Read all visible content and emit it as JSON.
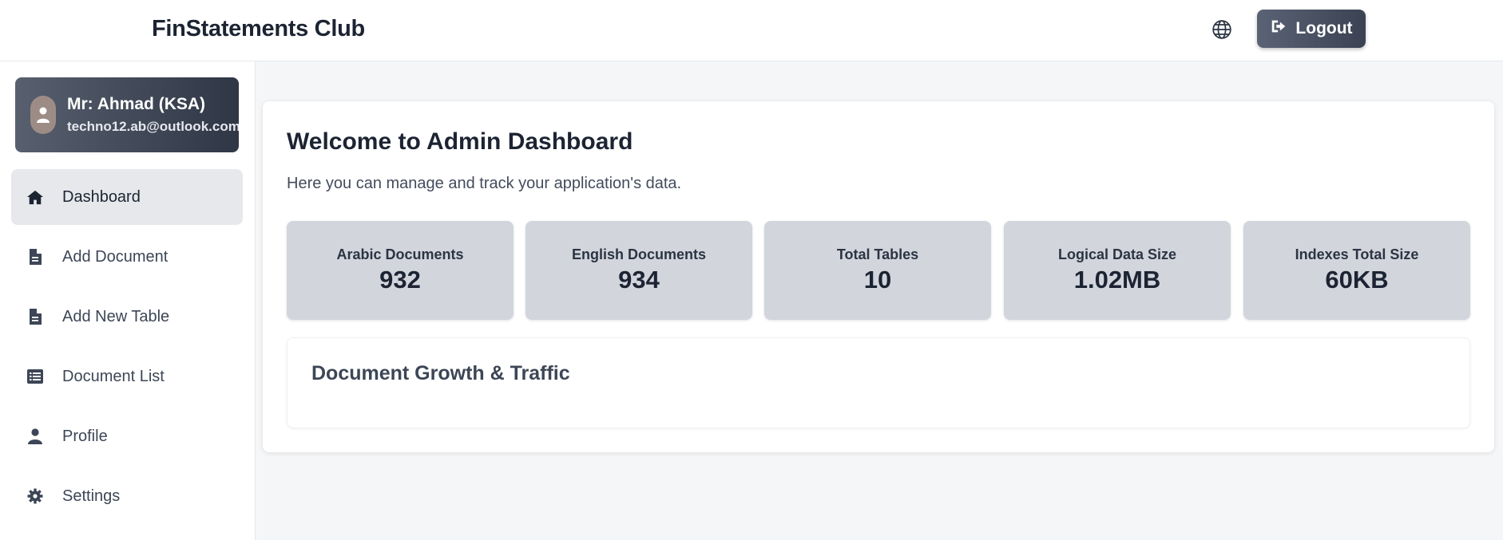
{
  "header": {
    "brand": "FinStatements Club",
    "logout_label": "Logout"
  },
  "user": {
    "name": "Mr: Ahmad (KSA)",
    "email": "techno12.ab@outlook.com"
  },
  "sidebar": {
    "items": [
      {
        "label": "Dashboard",
        "icon": "home-icon",
        "active": true
      },
      {
        "label": "Add Document",
        "icon": "document-icon"
      },
      {
        "label": "Add New Table",
        "icon": "document-icon"
      },
      {
        "label": "Document List",
        "icon": "list-icon"
      },
      {
        "label": "Profile",
        "icon": "user-icon"
      },
      {
        "label": "Settings",
        "icon": "gear-icon"
      }
    ]
  },
  "main": {
    "title": "Welcome to Admin Dashboard",
    "subtitle": "Here you can manage and track your application's data.",
    "stats": [
      {
        "label": "Arabic Documents",
        "value": "932"
      },
      {
        "label": "English Documents",
        "value": "934"
      },
      {
        "label": "Total Tables",
        "value": "10"
      },
      {
        "label": "Logical Data Size",
        "value": "1.02MB"
      },
      {
        "label": "Indexes Total Size",
        "value": "60KB"
      }
    ],
    "growth_title": "Document Growth & Traffic"
  },
  "colors": {
    "stat_card": "#d2d5dc",
    "active_nav": "#e6e8eb",
    "logout_button": "#3a4253"
  }
}
